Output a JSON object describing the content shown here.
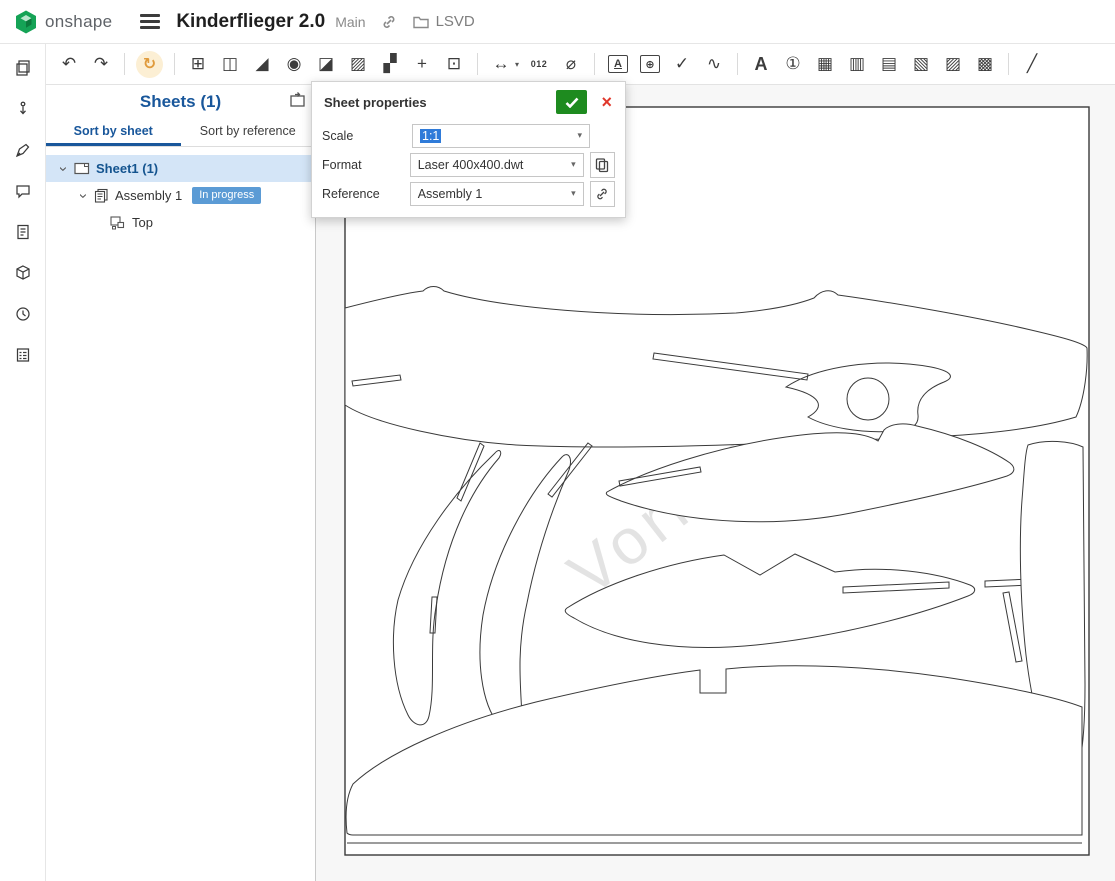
{
  "header": {
    "brand": "onshape",
    "title": "Kinderflieger 2.0",
    "workspace": "Main",
    "project": "LSVD"
  },
  "glyphs": {
    "chevron": "›",
    "caret": "▾",
    "close": "×"
  },
  "toolbar": {
    "icons": [
      {
        "name": "undo",
        "glyph": "↶"
      },
      {
        "name": "redo",
        "glyph": "↷"
      },
      {
        "name": "update-views",
        "glyph": "↻"
      },
      {
        "name": "insert-view",
        "glyph": "⊞"
      },
      {
        "name": "projected-view",
        "glyph": "◫"
      },
      {
        "name": "auxiliary-view",
        "glyph": "◢"
      },
      {
        "name": "detail-view",
        "glyph": "◉"
      },
      {
        "name": "section-view",
        "glyph": "◪"
      },
      {
        "name": "broken-out-section",
        "glyph": "▨"
      },
      {
        "name": "break-view",
        "glyph": "▞"
      },
      {
        "name": "move-view",
        "glyph": "+"
      },
      {
        "name": "crop-view",
        "glyph": "⊡"
      },
      {
        "name": "dimension",
        "glyph": "↔"
      },
      {
        "name": "ordinate-dimension",
        "glyph": "012"
      },
      {
        "name": "diameter-dimension",
        "glyph": "⌀"
      },
      {
        "name": "note",
        "glyph": "A"
      },
      {
        "name": "datum",
        "glyph": "⊕"
      },
      {
        "name": "check-dimension",
        "glyph": "✓"
      },
      {
        "name": "leader",
        "glyph": "∿"
      },
      {
        "name": "text",
        "glyph": "A"
      },
      {
        "name": "inspection-symbol",
        "glyph": "①"
      },
      {
        "name": "table",
        "glyph": "▦"
      },
      {
        "name": "bom-table",
        "glyph": "▥"
      },
      {
        "name": "hole-table",
        "glyph": "▤"
      },
      {
        "name": "revision-table",
        "glyph": "▧"
      },
      {
        "name": "weld-table",
        "glyph": "▨"
      },
      {
        "name": "bend-table",
        "glyph": "▩"
      },
      {
        "name": "sketch-line",
        "glyph": "╱"
      }
    ]
  },
  "left_rail": {
    "icons": [
      "sheets-panel-icon",
      "insert-icon",
      "markup-icon",
      "comments-icon",
      "notes-icon",
      "query-icon",
      "history-icon",
      "tables-icon"
    ]
  },
  "panel": {
    "title": "Sheets (1)",
    "tab_sheet": "Sort by sheet",
    "tab_reference": "Sort by reference",
    "rows": {
      "sheet": "Sheet1 (1)",
      "assembly": "Assembly 1",
      "status": "In progress",
      "view": "Top"
    }
  },
  "dialog": {
    "title": "Sheet properties",
    "scale_label": "Scale",
    "scale_value": "1:1",
    "format_label": "Format",
    "format_value": "Laser 400x400.dwt",
    "reference_label": "Reference",
    "reference_value": "Assembly 1"
  },
  "canvas": {
    "watermark": "Vorläufig"
  },
  "colors": {
    "accent": "#19579b",
    "selected_row": "#d4e5f7",
    "badge": "#5b9bd5",
    "confirm_green": "#1e8b1f",
    "cancel_red": "#e0372b",
    "update_orange": "#e09b3d"
  }
}
